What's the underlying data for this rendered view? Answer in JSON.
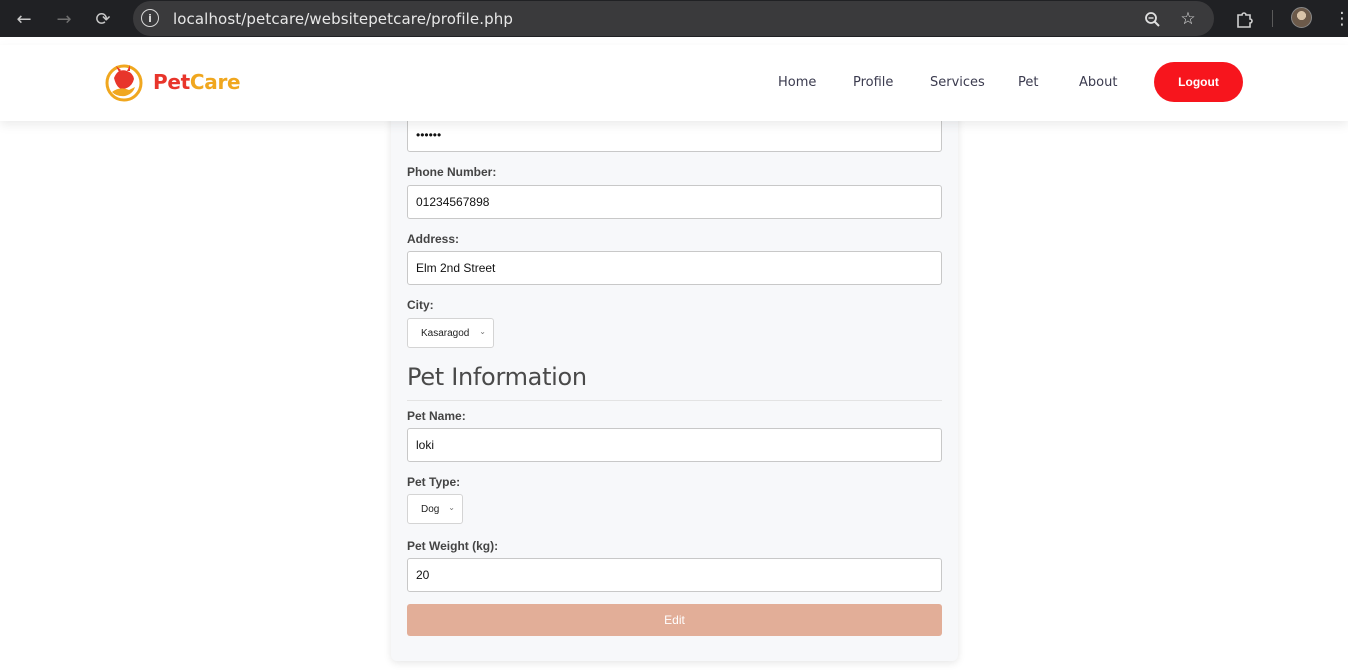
{
  "browser": {
    "url_host": "localhost",
    "url_path": "/petcare/websitepetcare/profile.php",
    "icons": {
      "back": "arrow-left-icon",
      "forward": "arrow-right-icon",
      "reload": "reload-icon",
      "site_info": "info-icon",
      "zoom": "zoom-icon",
      "bookmark": "star-icon",
      "extensions": "puzzle-icon",
      "menu": "kebab-menu-icon"
    }
  },
  "header": {
    "logo_pet": "Pet",
    "logo_care": "Care",
    "nav": [
      {
        "label": "Home"
      },
      {
        "label": "Profile"
      },
      {
        "label": "Services"
      },
      {
        "label": "Pet"
      },
      {
        "label": "About"
      }
    ],
    "logout_label": "Logout",
    "colors": {
      "brand_red": "#e8352b",
      "brand_orange": "#f0a71f",
      "logout_bg": "#f7151d"
    }
  },
  "form": {
    "password_value": "••••••",
    "phone": {
      "label": "Phone Number:",
      "value": "01234567898"
    },
    "address": {
      "label": "Address:",
      "value": "Elm 2nd Street"
    },
    "city": {
      "label": "City:",
      "selected": "Kasaragod"
    },
    "pet_section_title": "Pet Information",
    "pet_name": {
      "label": "Pet Name:",
      "value": "loki"
    },
    "pet_type": {
      "label": "Pet Type:",
      "selected": "Dog"
    },
    "pet_weight": {
      "label": "Pet Weight (kg):",
      "value": "20"
    },
    "edit_label": "Edit",
    "colors": {
      "edit_bg": "#e2ae98"
    }
  }
}
